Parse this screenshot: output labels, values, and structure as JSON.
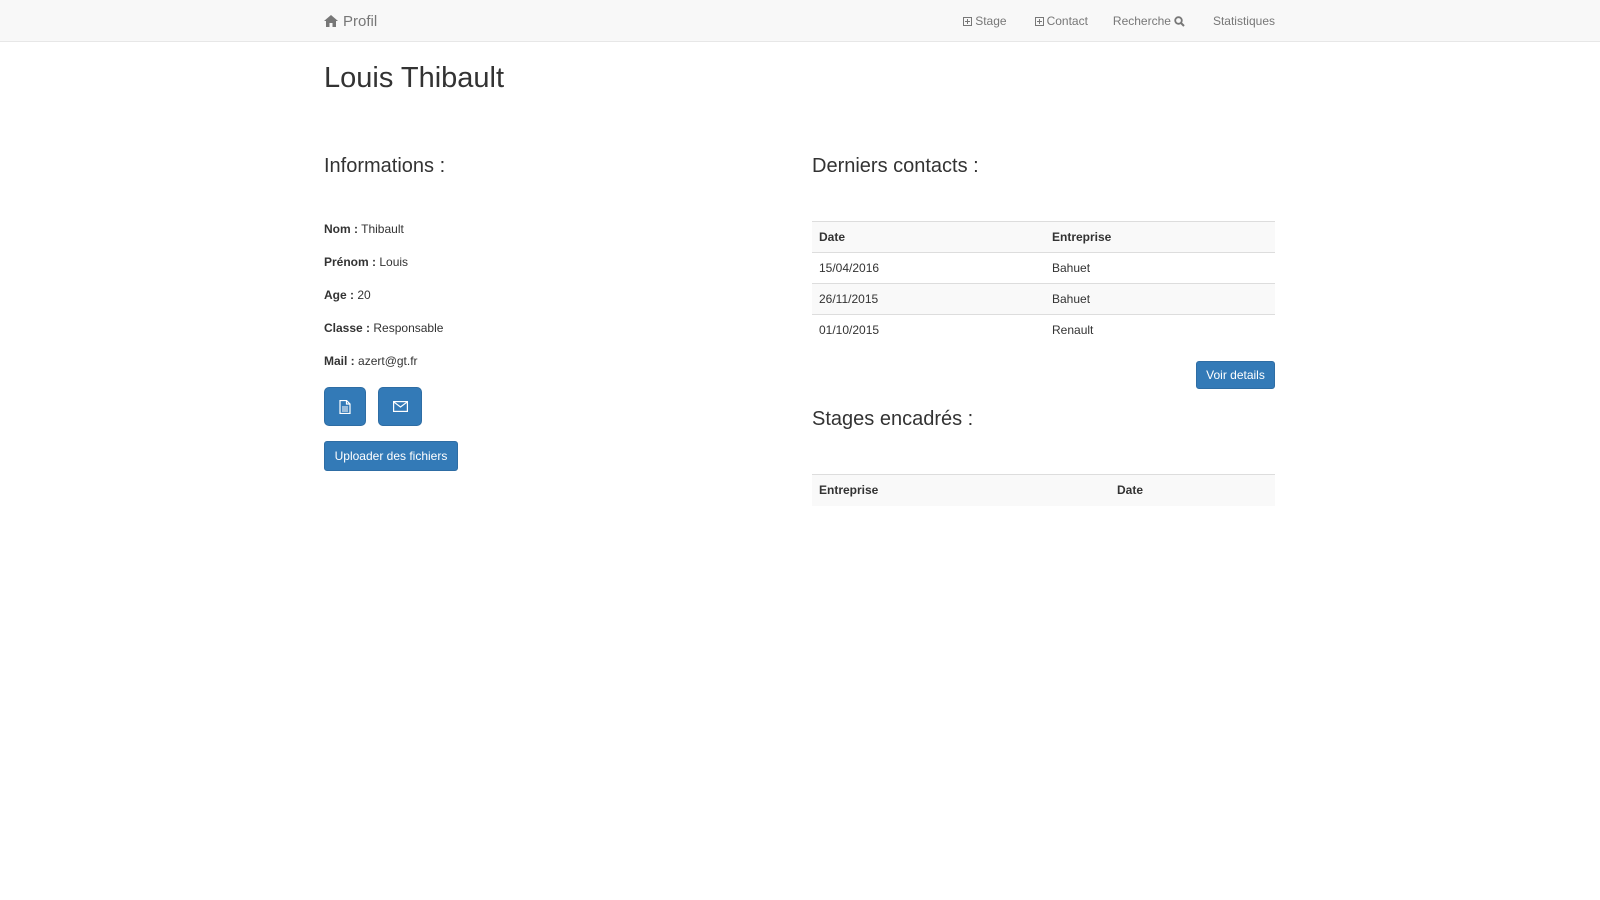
{
  "navbar": {
    "brand": "Profil",
    "brand_icon": "home-icon",
    "items": [
      {
        "label": "Stage",
        "icon": "plus-square-icon"
      },
      {
        "label": "Contact",
        "icon": "plus-square-icon"
      },
      {
        "label": "Recherche",
        "icon": "search-icon"
      },
      {
        "label": "Statistiques"
      }
    ]
  },
  "profile": {
    "name": "Louis Thibault"
  },
  "informations": {
    "title": "Informations :",
    "fields": [
      {
        "label": "Nom :",
        "value": "Thibault"
      },
      {
        "label": "Prénom :",
        "value": "Louis"
      },
      {
        "label": "Age :",
        "value": "20"
      },
      {
        "label": "Classe :",
        "value": "Responsable"
      },
      {
        "label": "Mail :",
        "value": "azert@gt.fr"
      }
    ],
    "upload_label": "Uploader des fichiers"
  },
  "contacts": {
    "title": "Derniers contacts :",
    "headers": [
      "Date",
      "Entreprise"
    ],
    "rows": [
      [
        "15/04/2016",
        "Bahuet"
      ],
      [
        "26/11/2015",
        "Bahuet"
      ],
      [
        "01/10/2015",
        "Renault"
      ]
    ],
    "details_label": "Voir details"
  },
  "stages": {
    "title": "Stages encadrés :",
    "headers": [
      "Entreprise",
      "Date"
    ]
  },
  "colors": {
    "primary": "#337ab7",
    "navbar_bg": "#f8f8f8",
    "text": "#333333",
    "muted": "#777777"
  }
}
